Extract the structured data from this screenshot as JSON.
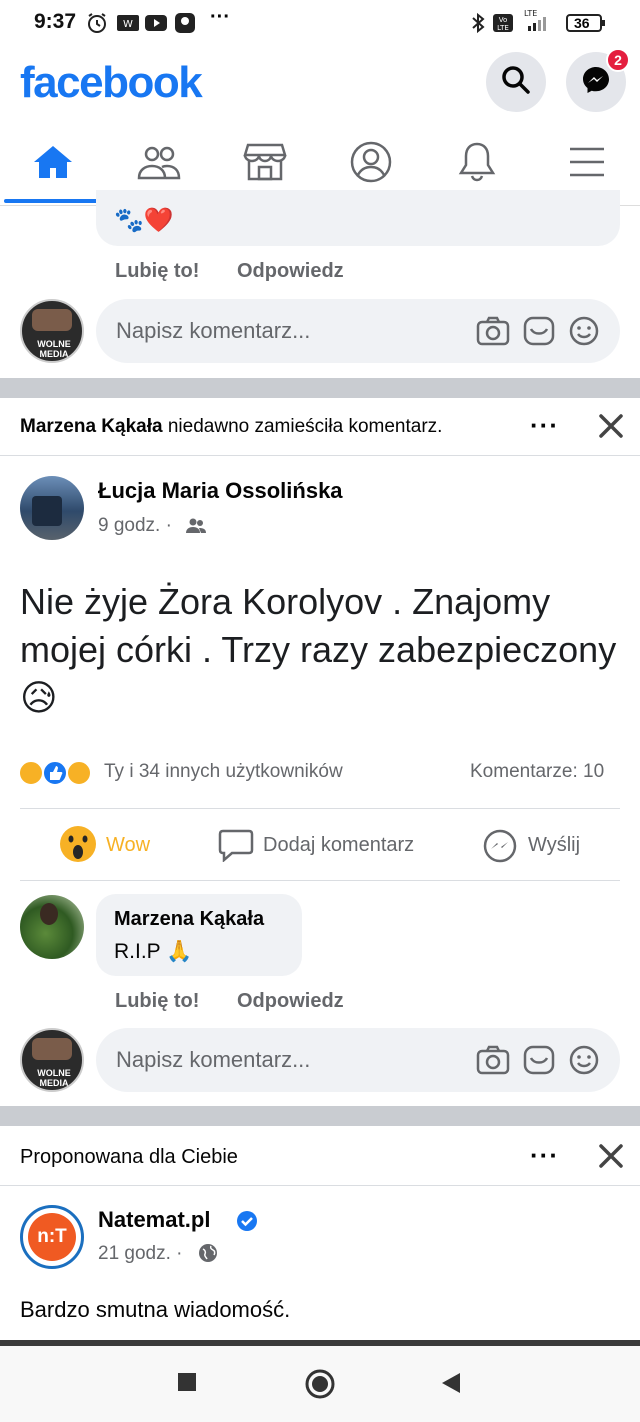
{
  "status_bar": {
    "time": "9:37",
    "battery": "36",
    "network": "LTE"
  },
  "header": {
    "logo": "facebook",
    "messenger_badge": "2"
  },
  "tabs": [
    {
      "name": "home",
      "icon": "home-icon",
      "active": true
    },
    {
      "name": "friends",
      "icon": "friends-icon"
    },
    {
      "name": "marketplace",
      "icon": "marketplace-icon"
    },
    {
      "name": "profile",
      "icon": "profile-icon"
    },
    {
      "name": "notifications",
      "icon": "bell-icon"
    },
    {
      "name": "menu",
      "icon": "hamburger-icon"
    }
  ],
  "top_comment": {
    "emoji": "🐾❤️",
    "like": "Lubię to!",
    "reply": "Odpowiedz"
  },
  "comment_input": {
    "placeholder": "Napisz komentarz...",
    "avatar_text": "WOLNE MEDIA"
  },
  "story1": {
    "activity_actor": "Marzena Kąkała",
    "activity_text": " niedawno zamieściła komentarz.",
    "author": "Łucja Maria Ossolińska",
    "time": "9 godz. ·",
    "body": "Nie żyje Żora Korolyov . Znajomy mojej córki . Trzy razy zabezpieczony 😥",
    "reactions_text": "Ty i 34 innych użytkowników",
    "comments_count": "Komentarze: 10",
    "actions": {
      "reaction": "Wow",
      "comment": "Dodaj komentarz",
      "send": "Wyślij"
    },
    "comment": {
      "author": "Marzena Kąkała",
      "text": "R.I.P 🙏",
      "like": "Lubię to!",
      "reply": "Odpowiedz"
    }
  },
  "story2": {
    "label": "Proponowana dla Ciebie",
    "page": "Natemat.pl",
    "avatar_text": "n:T",
    "time": "21 godz. ·",
    "body": "Bardzo smutna wiadomość."
  },
  "colors": {
    "brand": "#1877f2",
    "wow": "#f7b125",
    "badge": "#e41e3f"
  }
}
